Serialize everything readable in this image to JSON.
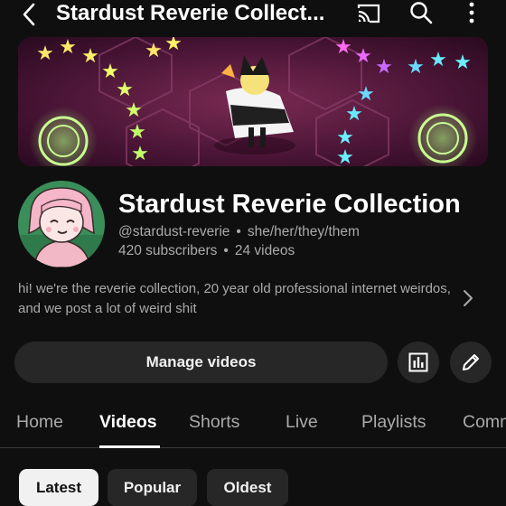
{
  "header": {
    "title": "Stardust Reverie Collect...",
    "back_icon": "chevron-left-icon",
    "cast_icon": "cast-icon",
    "search_icon": "search-icon",
    "more_icon": "more-vertical-icon"
  },
  "channel": {
    "name": "Stardust Reverie Collection",
    "handle": "@stardust-reverie",
    "pronouns": "she/her/they/them",
    "subscribers": "420 subscribers",
    "videos": "24 videos",
    "separator": "•",
    "description": "hi! we're the reverie collection, 20 year old professional internet weirdos, and we post a lot of weird shit"
  },
  "actions": {
    "manage_label": "Manage videos",
    "stats_icon": "analytics-icon",
    "edit_icon": "pencil-icon"
  },
  "tabs": [
    {
      "label": "Home",
      "active": false
    },
    {
      "label": "Videos",
      "active": true
    },
    {
      "label": "Shorts",
      "active": false
    },
    {
      "label": "Live",
      "active": false
    },
    {
      "label": "Playlists",
      "active": false
    },
    {
      "label": "Comm",
      "active": false
    }
  ],
  "chips": [
    {
      "label": "Latest",
      "selected": true
    },
    {
      "label": "Popular",
      "selected": false
    },
    {
      "label": "Oldest",
      "selected": false
    }
  ],
  "colors": {
    "background": "#0f0f0f",
    "surface": "#272727",
    "text_primary": "#f1f1f1",
    "text_secondary": "#aaaaaa"
  }
}
